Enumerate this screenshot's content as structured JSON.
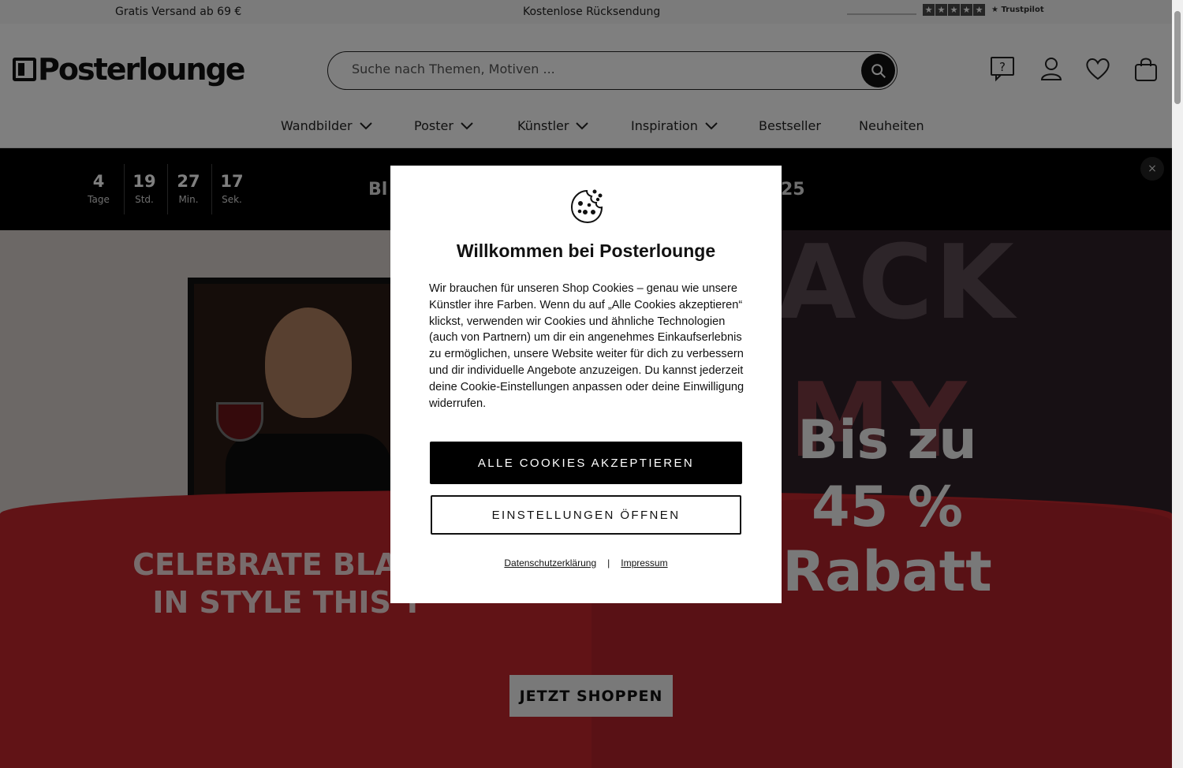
{
  "topbar": {
    "shipping": "Gratis Versand ab 69 €",
    "returns": "Kostenlose Rücksendung",
    "trustpilot_label": "Trustpilot",
    "trustpilot_rating_stars": 5
  },
  "header": {
    "logo_text": "Posterlounge",
    "search_placeholder": "Suche nach Themen, Motiven ...",
    "icons": [
      "help-icon",
      "account-icon",
      "wishlist-heart-icon",
      "shopping-bag-icon"
    ]
  },
  "nav": {
    "items": [
      {
        "label": "Wandbilder",
        "dropdown": true
      },
      {
        "label": "Poster",
        "dropdown": true
      },
      {
        "label": "Künstler",
        "dropdown": true
      },
      {
        "label": "Inspiration",
        "dropdown": true
      },
      {
        "label": "Bestseller",
        "dropdown": false
      },
      {
        "label": "Neuheiten",
        "dropdown": false
      }
    ]
  },
  "promo": {
    "countdown": [
      {
        "value": "4",
        "unit": "Tage"
      },
      {
        "value": "19",
        "unit": "Std."
      },
      {
        "value": "27",
        "unit": "Min."
      },
      {
        "value": "17",
        "unit": "Sek."
      }
    ],
    "text_left": "Bl",
    "text_right": "25",
    "close_label": "×"
  },
  "hero": {
    "bg_word_1": "ACK",
    "bg_word_2": "MY",
    "headline_1": "CELEBRATE BLACK",
    "headline_2": "IN STYLE THIS Y",
    "discount_1": "Bis zu",
    "discount_2": "45 %",
    "discount_3": "Rabatt",
    "cta": "JETZT SHOPPEN"
  },
  "cookie_modal": {
    "title": "Willkommen bei Posterlounge",
    "body": "Wir brauchen für unseren Shop Cookies – genau wie unsere Künstler ihre Farben. Wenn du auf „Alle Cookies akzeptieren“ klickst, verwenden wir Cookies und ähnliche Technologien (auch von Partnern) um dir ein angenehmes Einkaufserlebnis zu ermöglichen, unsere Website weiter für dich zu verbessern und dir individuelle Angebote anzuzeigen. Du kannst jederzeit deine Cookie-Einstellungen anpassen oder deine Einwilligung widerrufen.",
    "accept_label": "ALLE COOKIES AKZEPTIEREN",
    "settings_label": "EINSTELLUNGEN ÖFFNEN",
    "privacy_link": "Datenschutzerklärung",
    "separator": "|",
    "imprint_link": "Impressum"
  },
  "colors": {
    "hero_red": "#c2262c",
    "promo_black": "#000000",
    "accept_button": "#000000"
  }
}
